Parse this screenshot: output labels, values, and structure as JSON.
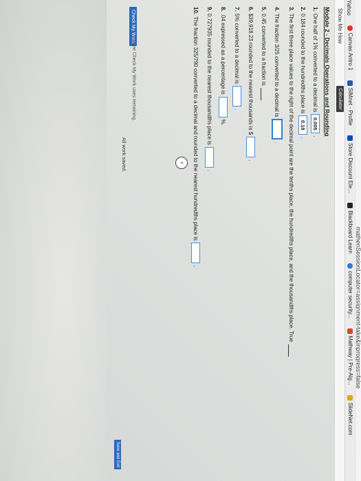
{
  "browser": {
    "url": "mathenSessionLocator=assignment-take&inprogress=false",
    "bookmarks": [
      {
        "label": "Yahoo",
        "icon": "yahoo-icon",
        "color": "#6001d2"
      },
      {
        "label": "Canvas Antro 1",
        "icon": "canvas-icon",
        "color": "#e4312b"
      },
      {
        "label": "SIMnet - Profile",
        "icon": "simnet-icon",
        "color": "#1f5fa8"
      },
      {
        "label": "Store Discount Ele...",
        "icon": "bestbuy-icon",
        "color": "#0a4abf"
      },
      {
        "label": "Blackboard Learn",
        "icon": "blackboard-icon",
        "color": "#222222"
      },
      {
        "label": "computer security...",
        "icon": "search-icon",
        "color": "#2a7ad6"
      },
      {
        "label": "Mathway | Pre-Alg...",
        "icon": "mathway-icon",
        "color": "#d94a2b"
      },
      {
        "label": "SlideNet.com",
        "icon": "slidenet-icon",
        "color": "#e8a21c"
      }
    ]
  },
  "toolbar": {
    "show_me_how": "Show Me How",
    "calculator": "Calculator"
  },
  "module": {
    "title": "Module 2 - Decimals Operations and Rounding"
  },
  "questions": [
    {
      "num": "1.",
      "text": "One half of 1% converted to a decimal is",
      "answer": "0.005",
      "suffix": "."
    },
    {
      "num": "2.",
      "text": "0.184 rounded to the hundredths place is",
      "answer": "0.18",
      "suffix": "."
    },
    {
      "num": "3.",
      "text": "The first three place values to the right of the decimal point are the tenths place, the hundredths place, and the thousandths place. True",
      "answer": "",
      "suffix": ""
    },
    {
      "num": "4.",
      "text": "The fraction 3/25 converted to a decimal is",
      "answer": "",
      "suffix": "."
    },
    {
      "num": "5.",
      "text": "0.45 converted to a fraction is",
      "answer": "",
      "suffix": ""
    },
    {
      "num": "6.",
      "text": "$39,918.23 rounded to the nearest thousands is $",
      "answer": "",
      "suffix": "."
    },
    {
      "num": "7.",
      "text": "5% converted to a decimal is",
      "answer": "",
      "suffix": "."
    },
    {
      "num": "8.",
      "text": ".04 expressed as a percentage is",
      "answer": "",
      "suffix": "%."
    },
    {
      "num": "9.",
      "text": "0.727935 rounded to the nearest thousandths place is",
      "answer": "",
      "suffix": "."
    },
    {
      "num": "10.",
      "text": "The fraction 325/790 converted to a decimal and rounded to the nearest hundredths place is",
      "answer": "",
      "suffix": "."
    }
  ],
  "footer": {
    "check_my_work": "Check My Work",
    "check_note": "5 more Check My Work uses remaining.",
    "saved": "All work saved.",
    "save_exit": "Save and Exit"
  }
}
